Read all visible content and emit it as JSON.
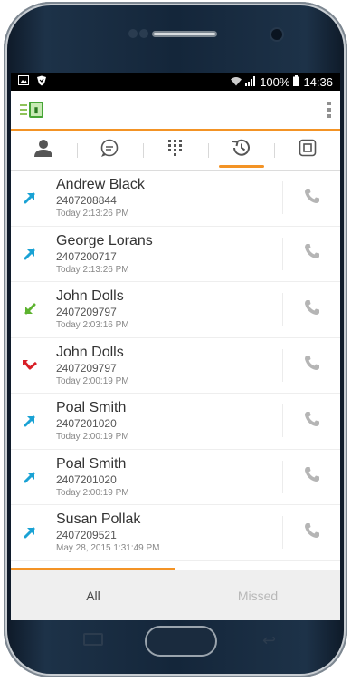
{
  "status_bar": {
    "left_icons": [
      "gallery-icon",
      "shield-icon"
    ],
    "battery": "100%",
    "time": "14:36"
  },
  "app_bar": {
    "logo_icon": "flag-logo-icon",
    "menu_icon": "kebab-menu-icon"
  },
  "tabs": [
    {
      "icon": "contacts-icon",
      "active": false
    },
    {
      "icon": "chat-icon",
      "active": false
    },
    {
      "icon": "dialpad-icon",
      "active": false
    },
    {
      "icon": "history-icon",
      "active": true
    },
    {
      "icon": "voicemail-icon",
      "active": false
    }
  ],
  "calls": [
    {
      "name": "Andrew Black",
      "number": "2407208844",
      "time": "Today 2:13:26 PM",
      "direction": "outgoing"
    },
    {
      "name": "George Lorans",
      "number": "2407200717",
      "time": "Today 2:13:26 PM",
      "direction": "outgoing"
    },
    {
      "name": "John Dolls",
      "number": "2407209797",
      "time": "Today 2:03:16 PM",
      "direction": "incoming"
    },
    {
      "name": "John Dolls",
      "number": "2407209797",
      "time": "Today 2:00:19 PM",
      "direction": "missed"
    },
    {
      "name": "Poal Smith",
      "number": "2407201020",
      "time": "Today 2:00:19 PM",
      "direction": "outgoing"
    },
    {
      "name": "Poal Smith",
      "number": "2407201020",
      "time": "Today 2:00:19 PM",
      "direction": "outgoing"
    },
    {
      "name": "Susan Pollak",
      "number": "2407209521",
      "time": "May 28, 2015 1:31:49 PM",
      "direction": "outgoing"
    }
  ],
  "bottom_tabs": {
    "all_label": "All",
    "missed_label": "Missed"
  },
  "colors": {
    "accent": "#f39325",
    "outgoing": "#1aa2d4",
    "incoming": "#5db32f",
    "missed": "#d81e26",
    "phone_icon": "#b5b5b5"
  }
}
